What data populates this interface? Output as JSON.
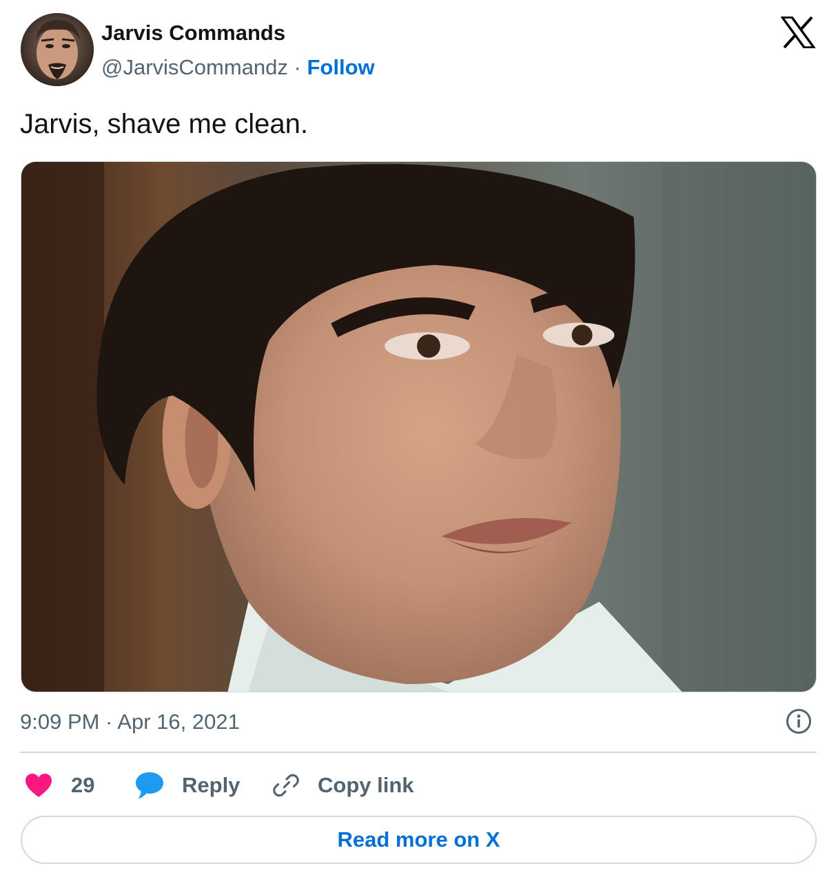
{
  "author": {
    "display_name": "Jarvis Commands",
    "handle": "@JarvisCommandz",
    "separator": "·",
    "follow_label": "Follow",
    "avatar_icon": "avatar-photo"
  },
  "platform": {
    "logo_icon": "x-logo-icon"
  },
  "tweet": {
    "text": "Jarvis, shave me clean.",
    "media_icon": "photo",
    "timestamp": "9:09 PM · Apr 16, 2021"
  },
  "meta": {
    "info_icon": "info-icon"
  },
  "actions": {
    "like": {
      "icon": "heart-icon",
      "count": "29",
      "color": "#f91880"
    },
    "reply": {
      "icon": "speech-bubble-icon",
      "label": "Reply",
      "color": "#1d9bf0"
    },
    "copy_link": {
      "icon": "link-icon",
      "label": "Copy link"
    }
  },
  "read_more": {
    "label": "Read more on X"
  },
  "colors": {
    "text_primary": "#0f1419",
    "text_secondary": "#536471",
    "link": "#006fd6",
    "border": "#cfd9de"
  }
}
